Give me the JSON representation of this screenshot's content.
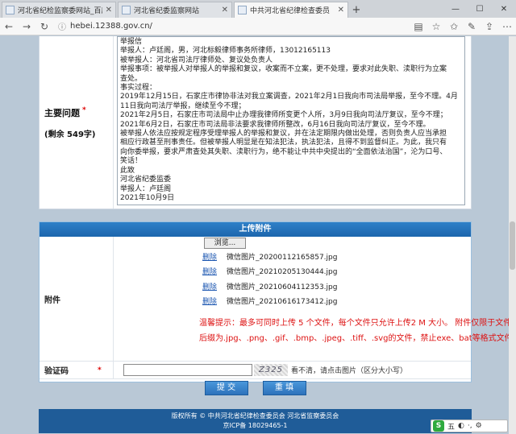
{
  "browser": {
    "tabs": [
      {
        "label": "河北省纪检监察委网站_百度",
        "active": false
      },
      {
        "label": "河北省纪委监察网站",
        "active": false
      },
      {
        "label": "中共河北省纪律检查委员",
        "active": true
      }
    ],
    "url": "hebei.12388.gov.cn/",
    "controls": {
      "minimize": "—",
      "maximize": "☐",
      "close": "✕"
    }
  },
  "problem": {
    "label": "主要问题",
    "required_mark": "*",
    "remaining": "(剩余      549字)",
    "lines": [
      "举报信",
      "举报人：卢廷阁，男，河北标毅律师事务所律师，13012165113",
      "被举报人：河北省司法厅律师处、复议处负责人",
      "举报事项：被举报人对举报人的举报和复议，收案而不立案，更不处理，要求对此失职、渎职行为立案",
      "查处。",
      "事实过程：",
      "2019年12月15日，石家庄市律协非法对我立案调查，2021年2月1日我向市司法局举报，至今不理。4月",
      "11日我向司法厅举报，继续至今不理；",
      "2021年2月5日，石家庄市司法局中止办理我律师所变更个人所，3月9日我向司法厅复议，至今不理；",
      "2021年6月2日，石家庄市司法局非法要求我律师所整改，6月16日我向司法厅复议，至今不理。",
      "被举报人依法应按规定程序受理举报人的举报和复议，并在法定期限内做出处理，否则负责人应当承担",
      "相应行政甚至刑事责任。但被举报人明显是在知法犯法，执法犯法，且得不到监督纠正。为此，我只有",
      "向你委举报，要求严肃查处其失职、渎职行为，绝不能让中共中央提出的“全面依法治国”，沦为口号、",
      "笑话！",
      "此致",
      "河北省纪委监委",
      "举报人：卢廷阁",
      "2021年10月9日"
    ]
  },
  "upload": {
    "header": "上传附件",
    "attach_label": "附件",
    "browse_label": "浏览...",
    "delete_label": "删除",
    "files": [
      "微信图片_20200112165857.jpg",
      "微信图片_20210205130444.jpg",
      "微信图片_20210604112353.jpg",
      "微信图片_20210616173412.jpg"
    ],
    "tip_line1": "温馨提示：最多可同时上传 5 个文件，每个文件只允许上传2 M 大小。 附件仅限于文件名",
    "tip_line2": "后缀为.jpg、.png、.gif、.bmp、.jpeg、.tiff、.svg的文件，禁止exe、bat等格式文件上传!"
  },
  "captcha": {
    "label": "验证码",
    "required_mark": "*",
    "image_text": "Z325",
    "hint": "看不清，请点击图片（区分大小写）"
  },
  "buttons": {
    "submit": "提 交",
    "reset": "重 填"
  },
  "footer": {
    "line1": "版权所有 © 中共河北省纪律检查委员会 河北省监察委员会",
    "line2": "京ICP备 18029465-1"
  },
  "ime": {
    "logo": "S",
    "mode": "五",
    "punct": "◐",
    "symbols": "·,",
    "settings": "⚙"
  }
}
